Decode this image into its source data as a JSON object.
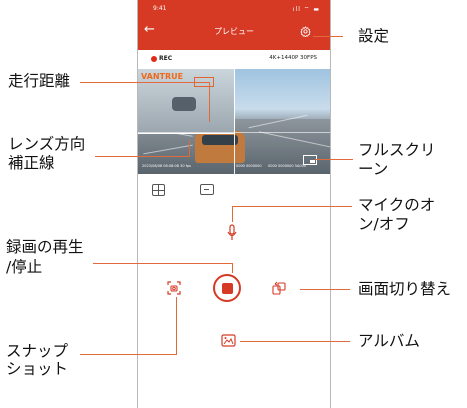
{
  "status_bar": {
    "time": "9:41",
    "icons": "ıll ⌔ ▬"
  },
  "header": {
    "back": "←",
    "title": "プレビュー"
  },
  "preview": {
    "rec": "REC",
    "resolution": "4K+1440P 30FPS",
    "logo": "VANTRUE",
    "overlay_left": "2023/08/08 08:08:08 30 fps",
    "overlay_mid": "0000 0000000",
    "overlay_right": "0000 0000000 5A000"
  },
  "callouts": {
    "settings": "設定",
    "mileage": "走行距離",
    "lens_line_1": "レンズ方向",
    "lens_line_2": "補正線",
    "fullscreen_1": "フルスクリ",
    "fullscreen_2": "ーン",
    "mic_1": "マイクのオ",
    "mic_2": "ン/オフ",
    "record_1": "録画の再生",
    "record_2": "/停止",
    "switch": "画面切り替え",
    "snapshot_1": "スナップ",
    "snapshot_2": "ショット",
    "album": "アルバム"
  },
  "colors": {
    "accent": "#d63a24",
    "line": "#e06a3a"
  }
}
